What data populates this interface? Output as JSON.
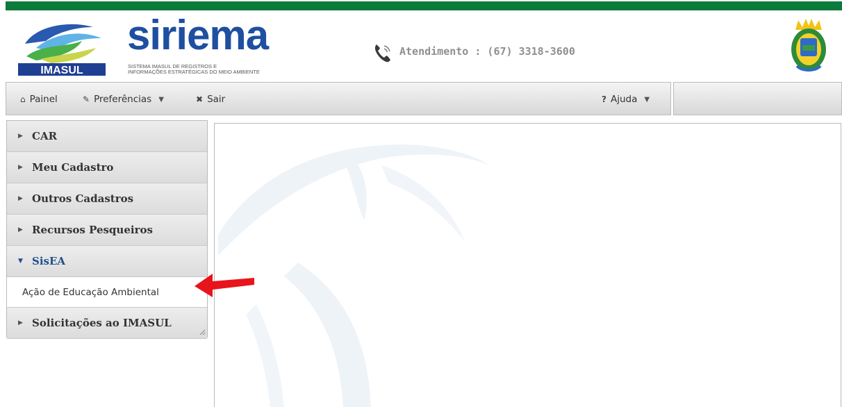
{
  "brand": {
    "imasul_logo_text": "IMASUL",
    "title": "siriema",
    "subtitle_line1": "SISTEMA IMASUL DE REGISTROS E",
    "subtitle_line2": "INFORMAÇÕES ESTRATÉGICAS DO MEIO AMBIENTE"
  },
  "contact": {
    "text": "Atendimento : (67) 3318-3600",
    "icon": "phone-icon"
  },
  "nav": {
    "painel": "Painel",
    "preferencias": "Preferências",
    "sair": "Sair",
    "ajuda": "Ajuda"
  },
  "sidebar": {
    "items": [
      {
        "label": "CAR",
        "expanded": false
      },
      {
        "label": "Meu Cadastro",
        "expanded": false
      },
      {
        "label": "Outros Cadastros",
        "expanded": false
      },
      {
        "label": "Recursos Pesqueiros",
        "expanded": false
      },
      {
        "label": "SisEA",
        "expanded": true,
        "children": [
          "Ação de Educação Ambiental"
        ]
      },
      {
        "label": "Solicitações ao IMASUL",
        "expanded": false
      }
    ]
  },
  "colors": {
    "top_bar": "#0b7a3b",
    "brand_blue": "#1e4fa0",
    "active_menu": "#1f4f8a",
    "annotation_arrow": "#e8141b"
  }
}
